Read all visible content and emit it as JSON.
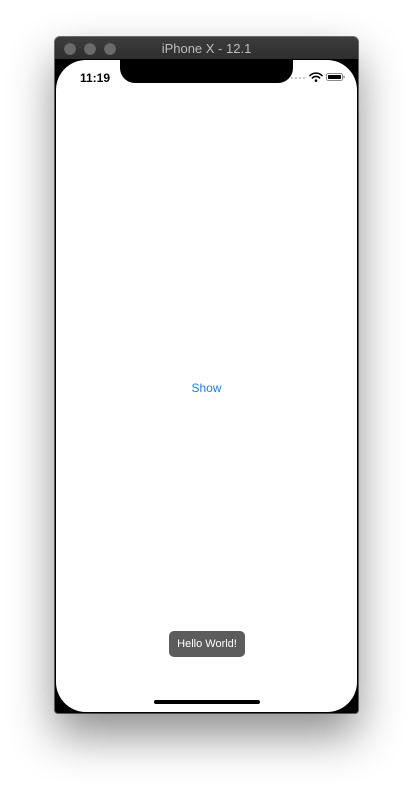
{
  "window": {
    "title": "iPhone X - 12.1"
  },
  "status_bar": {
    "time": "11:19",
    "icons": [
      "cellular-dots-icon",
      "wifi-icon",
      "battery-icon"
    ]
  },
  "main": {
    "show_button_label": "Show"
  },
  "toast": {
    "message": "Hello World!"
  },
  "colors": {
    "accent": "#1a7ff0",
    "toast_background": "#5c5c5c",
    "screen_background": "#ffffff"
  }
}
